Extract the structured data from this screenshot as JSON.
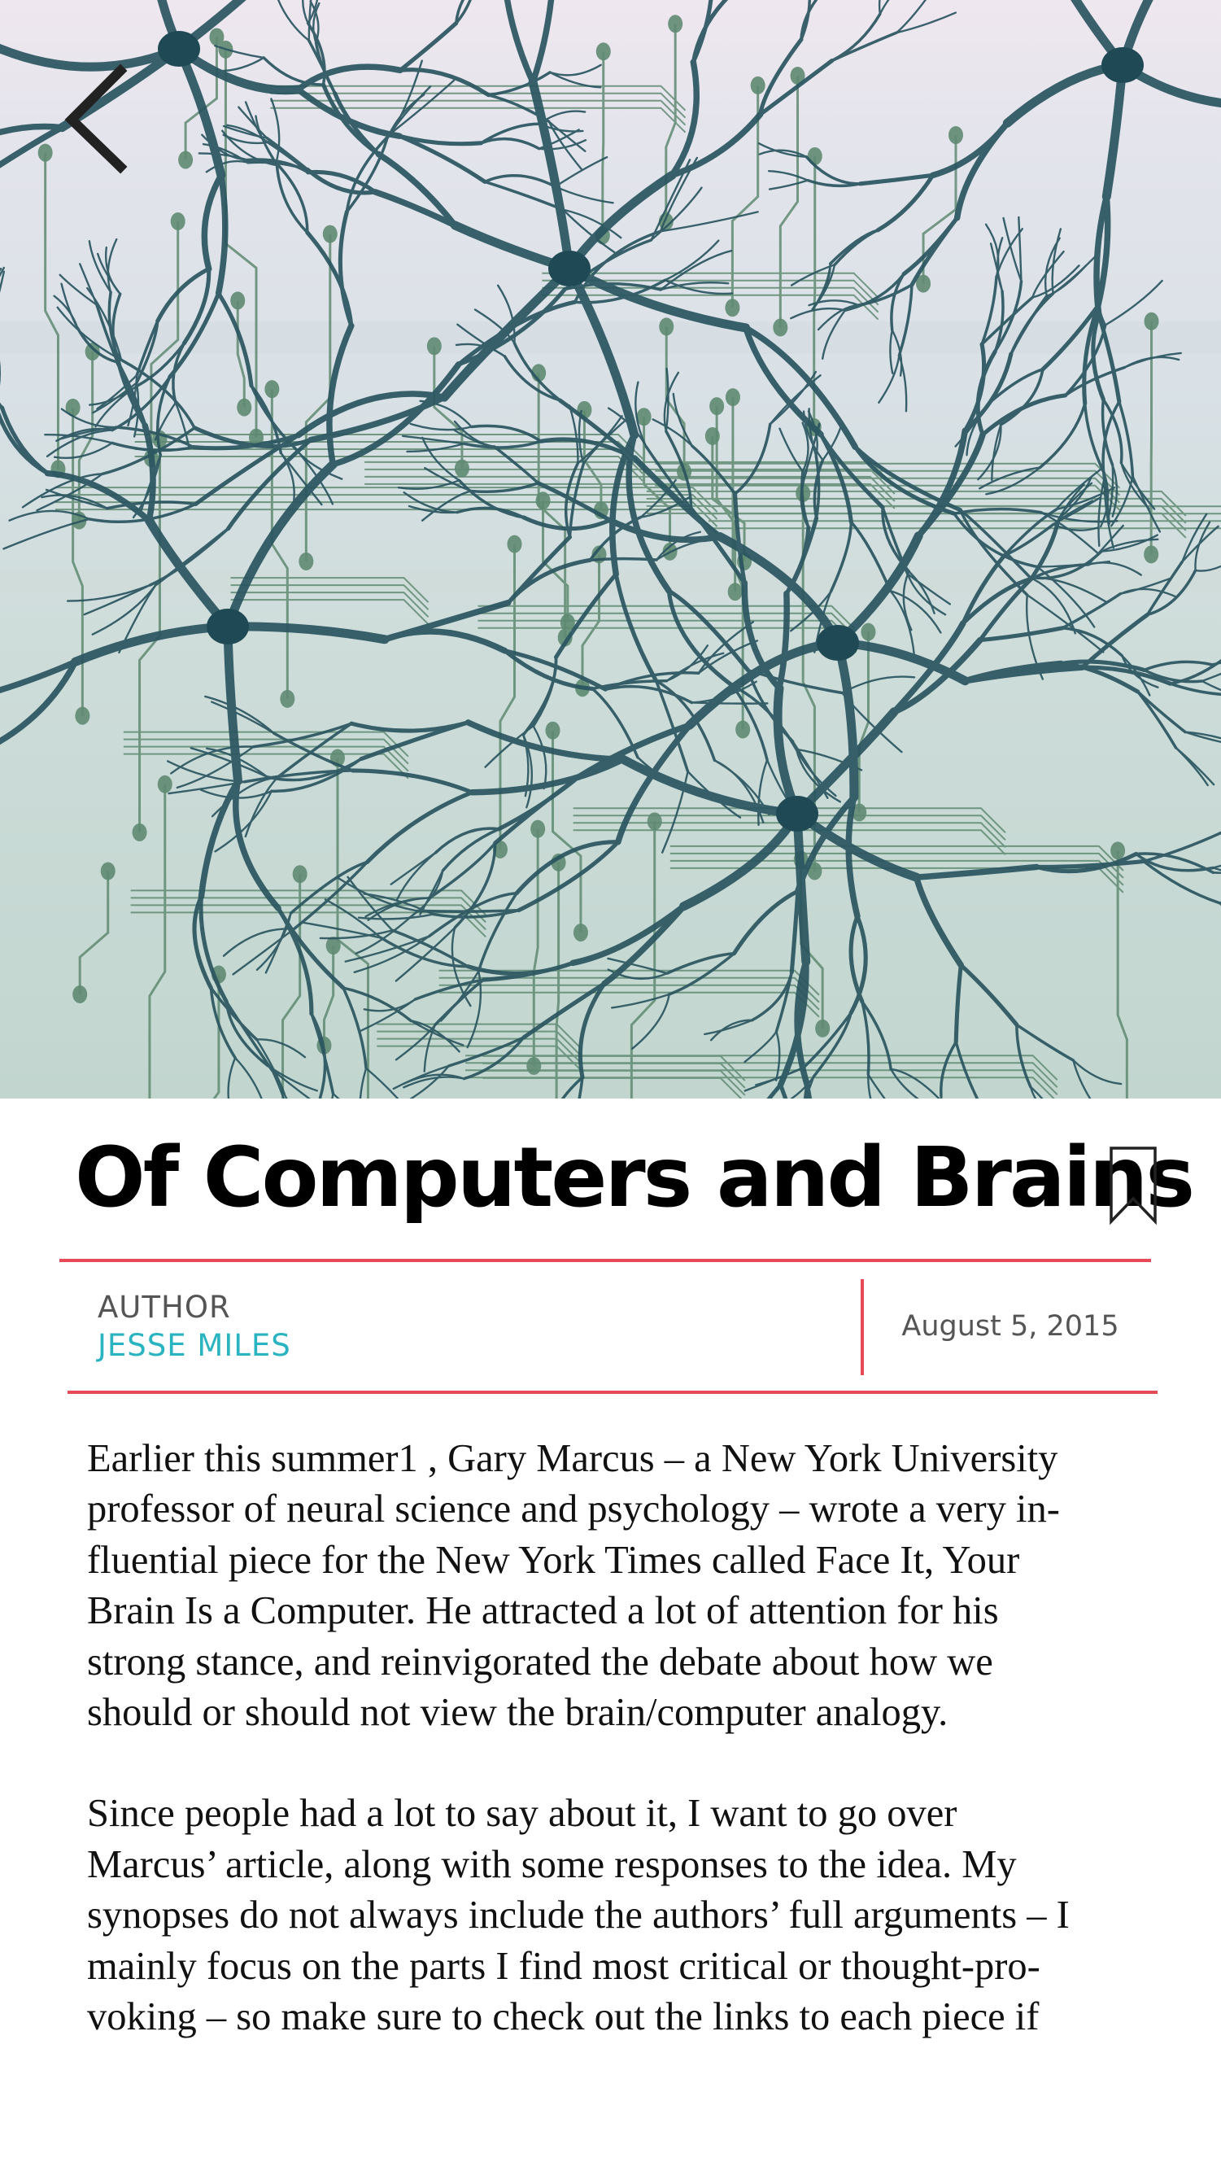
{
  "header": {
    "back_icon": "chevron-left-icon",
    "hero_image": "neurons-over-circuit-board illustration"
  },
  "article": {
    "title": "Of Computers and Brains",
    "bookmark_icon": "bookmark-icon",
    "author_label": "AUTHOR",
    "author_name": "JESSE MILES",
    "date": "August 5, 2015",
    "paragraphs": [
      [
        "Earlier this summer1 , Gary Marcus – a New York University",
        "professor of neural science and psychology –  wrote a very in-",
        "fluential piece for the New York Times called Face It, Your",
        "Brain Is a Computer. He attracted a lot of attention for his",
        "strong stance, and reinvigorated the debate about how we",
        "should or should not view the brain/computer analogy."
      ],
      [
        "Since people had a lot to say about it, I want to go over",
        "Marcus’ article, along with some responses to the idea. My",
        "synopses do not always include the authors’ full arguments – I",
        "mainly focus on the parts I find most critical or thought-pro-",
        "voking – so make sure to check out the links to each piece if"
      ]
    ]
  },
  "colors": {
    "accent_rule": "#e64a57",
    "author_name": "#2ab3c0",
    "neuron": "#2a5560",
    "circuit": "#5f8a72"
  }
}
